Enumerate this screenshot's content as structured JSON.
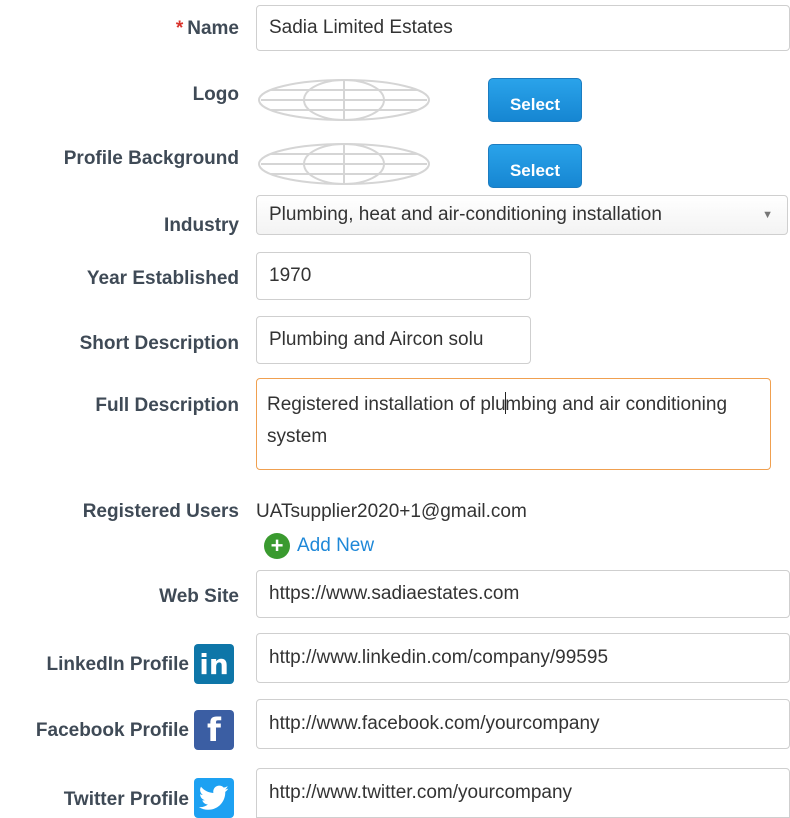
{
  "form": {
    "name": {
      "required_mark": "*",
      "label": "Name",
      "value": "Sadia Limited Estates"
    },
    "logo": {
      "label": "Logo",
      "button_label": "Select"
    },
    "profile_background": {
      "label": "Profile Background",
      "button_label": "Select"
    },
    "industry": {
      "label": "Industry",
      "value": "Plumbing, heat and air-conditioning installation",
      "arrow_glyph": "▼"
    },
    "year_established": {
      "label": "Year Established",
      "value": "1970"
    },
    "short_description": {
      "label": "Short Description",
      "value": "Plumbing and Aircon solu"
    },
    "full_description": {
      "label": "Full Description",
      "value_before_caret": "Registered installation of plu",
      "value_after_caret": "mbing and air conditioning system"
    },
    "registered_users": {
      "label": "Registered Users",
      "email": "UATsupplier2020+1@gmail.com",
      "add_new_label": "Add New",
      "add_icon_glyph": "+"
    },
    "web_site": {
      "label": "Web Site",
      "value": "https://www.sadiaestates.com"
    },
    "linkedin": {
      "label": "LinkedIn Profile",
      "icon_text": "in",
      "value": "http://www.linkedin.com/company/99595"
    },
    "facebook": {
      "label": "Facebook Profile",
      "icon_text": "f",
      "value": "http://www.facebook.com/yourcompany"
    },
    "twitter": {
      "label": "Twitter Profile",
      "value": "http://www.twitter.com/yourcompany"
    }
  },
  "colors": {
    "label": "#3f4a56",
    "required": "#d9332b",
    "select_button": "#1e8fdd",
    "focus_border": "#f0a050",
    "link": "#1e88d8",
    "add_icon": "#3a9a2f",
    "linkedin": "#0e76a8",
    "facebook": "#3b5ea3",
    "twitter": "#1da1f2"
  },
  "icons": {
    "logo_placeholder": "globe-placeholder-icon",
    "add": "plus-circle-icon",
    "linkedin": "linkedin-icon",
    "facebook": "facebook-icon",
    "twitter": "twitter-bird-icon",
    "dropdown": "caret-down-icon"
  }
}
